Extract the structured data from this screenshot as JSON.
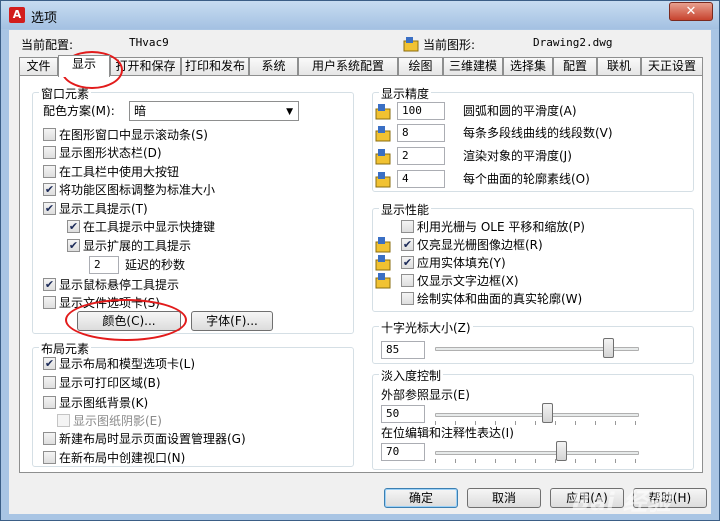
{
  "window": {
    "title": "选项",
    "close_icon": "close-icon"
  },
  "profile": {
    "current_profile_label": "当前配置:",
    "current_profile_value": "THvac9",
    "current_drawing_label": "当前图形:",
    "current_drawing_value": "Drawing2.dwg"
  },
  "tabs": [
    {
      "label": "文件"
    },
    {
      "label": "显示"
    },
    {
      "label": "打开和保存"
    },
    {
      "label": "打印和发布"
    },
    {
      "label": "系统"
    },
    {
      "label": "用户系统配置"
    },
    {
      "label": "绘图"
    },
    {
      "label": "三维建模"
    },
    {
      "label": "选择集"
    },
    {
      "label": "配置"
    },
    {
      "label": "联机"
    },
    {
      "label": "天正设置"
    }
  ],
  "window_elements": {
    "title": "窗口元素",
    "color_scheme_label": "配色方案(M):",
    "color_scheme_value": "暗",
    "checks": [
      {
        "label": "在图形窗口中显示滚动条(S)",
        "checked": false
      },
      {
        "label": "显示图形状态栏(D)",
        "checked": false
      },
      {
        "label": "在工具栏中使用大按钮",
        "checked": false
      },
      {
        "label": "将功能区图标调整为标准大小",
        "checked": true
      },
      {
        "label": "显示工具提示(T)",
        "checked": true
      },
      {
        "label": "在工具提示中显示快捷键",
        "checked": true
      },
      {
        "label": "显示扩展的工具提示",
        "checked": true
      }
    ],
    "delay_value": "2",
    "delay_label": "延迟的秒数",
    "checks2": [
      {
        "label": "显示鼠标悬停工具提示",
        "checked": true
      },
      {
        "label": "显示文件选项卡(S)",
        "checked": false
      }
    ],
    "colors_button": "颜色(C)...",
    "fonts_button": "字体(F)..."
  },
  "layout_elements": {
    "title": "布局元素",
    "checks": [
      {
        "label": "显示布局和模型选项卡(L)",
        "checked": true
      },
      {
        "label": "显示可打印区域(B)",
        "checked": false
      },
      {
        "label": "显示图纸背景(K)",
        "checked": false
      },
      {
        "label": "显示图纸阴影(E)",
        "checked": false
      },
      {
        "label": "新建布局时显示页面设置管理器(G)",
        "checked": false
      },
      {
        "label": "在新布局中创建视口(N)",
        "checked": false
      }
    ]
  },
  "resolution": {
    "title": "显示精度",
    "rows": [
      {
        "value": "100",
        "label": "圆弧和圆的平滑度(A)"
      },
      {
        "value": "8",
        "label": "每条多段线曲线的线段数(V)"
      },
      {
        "value": "2",
        "label": "渲染对象的平滑度(J)"
      },
      {
        "value": "4",
        "label": "每个曲面的轮廓素线(O)"
      }
    ]
  },
  "performance": {
    "title": "显示性能",
    "checks": [
      {
        "label": "利用光栅与 OLE 平移和缩放(P)",
        "checked": false
      },
      {
        "label": "仅亮显光栅图像边框(R)",
        "checked": true
      },
      {
        "label": "应用实体填充(Y)",
        "checked": true
      },
      {
        "label": "仅显示文字边框(X)",
        "checked": false
      },
      {
        "label": "绘制实体和曲面的真实轮廓(W)",
        "checked": false
      }
    ]
  },
  "crosshair": {
    "title": "十字光标大小(Z)",
    "value": "85",
    "fraction": 0.85
  },
  "fade": {
    "title": "淡入度控制",
    "xref_label": "外部参照显示(E)",
    "xref_value": "50",
    "xref_fraction": 0.55,
    "inplace_label": "在位编辑和注释性表达(I)",
    "inplace_value": "70",
    "inplace_fraction": 0.62
  },
  "buttons": {
    "ok": "确定",
    "cancel": "取消",
    "apply": "应用(A)",
    "help": "帮助(H)"
  },
  "watermark": "Bai 经验",
  "colors": {
    "annotation": "#e21b1b",
    "title_bar": "#a9c5e4"
  }
}
